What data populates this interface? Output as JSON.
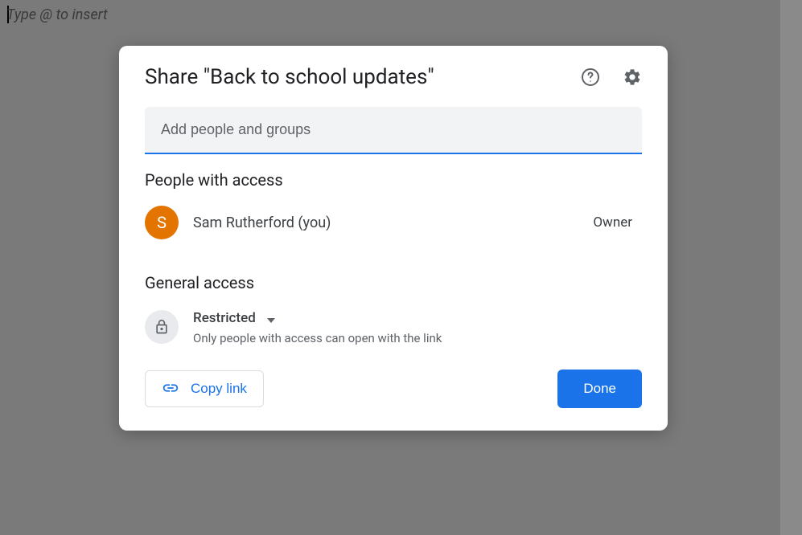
{
  "background": {
    "placeholder": "Type @ to insert"
  },
  "dialog": {
    "title": "Share \"Back to school updates\"",
    "input": {
      "placeholder": "Add people and groups"
    },
    "people_section": {
      "heading": "People with access",
      "people": [
        {
          "initial": "S",
          "name": "Sam Rutherford (you)",
          "role": "Owner"
        }
      ]
    },
    "general_section": {
      "heading": "General access",
      "mode": "Restricted",
      "description": "Only people with access can open with the link"
    },
    "copy_link_label": "Copy link",
    "done_label": "Done"
  }
}
